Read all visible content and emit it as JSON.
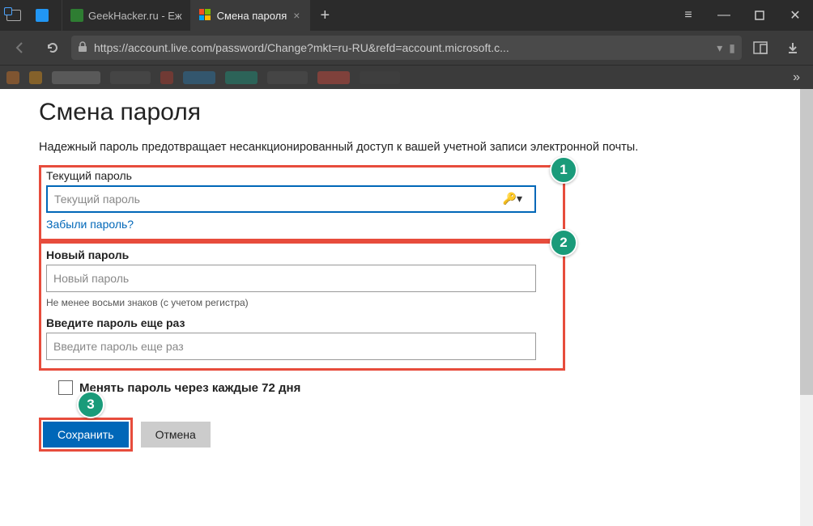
{
  "browser": {
    "tabs": [
      {
        "title": " ",
        "active": false
      },
      {
        "title": "GeekHacker.ru - Еж",
        "active": false
      },
      {
        "title": "Смена пароля",
        "active": true
      }
    ],
    "url": "https://account.live.com/password/Change?mkt=ru-RU&refd=account.microsoft.c..."
  },
  "page": {
    "heading": "Смена пароля",
    "description": "Надежный пароль предотвращает несанкционированный доступ к вашей учетной записи электронной почты.",
    "current_pw_label": "Текущий пароль",
    "current_pw_placeholder": "Текущий пароль",
    "forgot_link": "Забыли пароль?",
    "new_pw_label": "Новый пароль",
    "new_pw_placeholder": "Новый пароль",
    "hint": "Не менее восьми знаков (с учетом регистра)",
    "confirm_pw_label": "Введите пароль еще раз",
    "confirm_pw_placeholder": "Введите пароль еще раз",
    "checkbox_label": "Менять пароль через каждые 72 дня",
    "save_btn": "Сохранить",
    "cancel_btn": "Отмена"
  },
  "annotations": {
    "b1": "1",
    "b2": "2",
    "b3": "3"
  }
}
